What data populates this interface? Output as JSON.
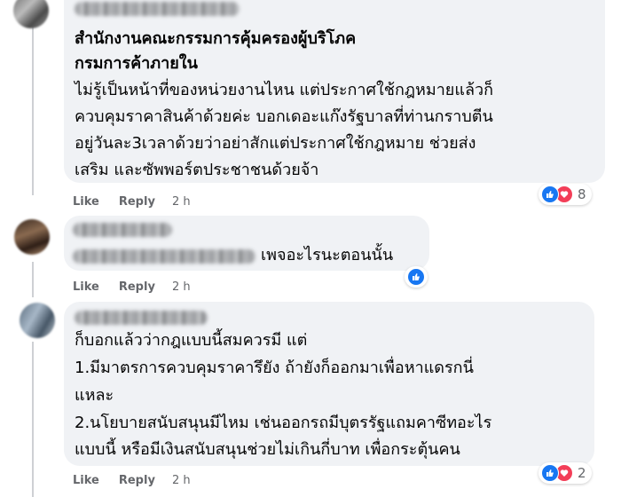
{
  "comments": [
    {
      "title_lines": [
        "สำนักงานคณะกรรมการคุ้มครองผู้บริโภค",
        "กรมการค้าภายใน"
      ],
      "lines": [
        "ไม่รู้เป็นหน้าที่ของหน่วยงานไหน แต่ประกาศใช้กฎหมายแล้วก็",
        "ควบคุมราคาสินค้าด้วยค่ะ บอกเดอะแก๊งรัฐบาลที่ท่านกราบตีน",
        "อยู่วันละ3เวลาด้วยว่าอย่าสักแต่ประกาศใช้กฎหมาย ช่วยส่ง",
        "เสริม และซัพพอร์ตประชาชนด้วยจ้า"
      ],
      "actions": {
        "like": "Like",
        "reply": "Reply",
        "time": "2 h"
      },
      "reactions": {
        "icons": [
          "like-icon",
          "love-icon"
        ],
        "count": "8"
      }
    },
    {
      "lines": [
        "เพจอะไรนะตอนนั้น"
      ],
      "actions": {
        "like": "Like",
        "reply": "Reply",
        "time": "2 h"
      },
      "reactions": {
        "icons": [
          "like-icon"
        ],
        "count": ""
      }
    },
    {
      "lines": [
        "ก็บอกแล้วว่ากฎแบบนี้สมควรมี แต่",
        "1.มีมาตรการควบคุมราคารึยัง ถ้ายังก็ออกมาเพื่อหาแดรกนี่",
        "แหละ",
        "2.นโยบายสนับสนุนมีไหม เช่นออกรถมีบุตรรัฐแถมคาซีทอะไร",
        "แบบนี้ หรือมีเงินสนับสนุนช่วยไม่เกินกี่บาท เพื่อกระตุ้นคน"
      ],
      "actions": {
        "like": "Like",
        "reply": "Reply",
        "time": "2 h"
      },
      "reactions": {
        "icons": [
          "like-icon",
          "love-icon"
        ],
        "count": "2"
      }
    }
  ],
  "colors": {
    "bubble": "#f0f2f5",
    "like": "#1877f2",
    "love": "#f33e58",
    "meta": "#65676b"
  }
}
